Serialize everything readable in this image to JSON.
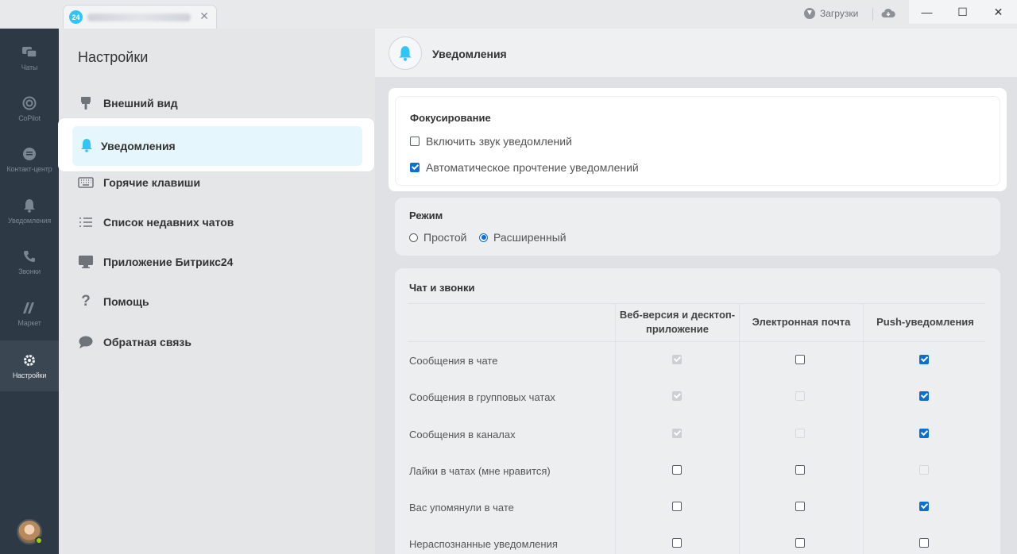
{
  "titlebar": {
    "tab_logo": "24",
    "downloads_label": "Загрузки",
    "close_glyph": "✕",
    "minimize_glyph": "—",
    "maximize_glyph": "☐",
    "tab_close_glyph": "✕"
  },
  "leftnav": {
    "items": [
      {
        "label": "Чаты",
        "icon": "chat-icon"
      },
      {
        "label": "CoPilot",
        "icon": "copilot-icon"
      },
      {
        "label": "Контакт-центр",
        "icon": "contact-center-icon"
      },
      {
        "label": "Уведомления",
        "icon": "bell-icon"
      },
      {
        "label": "Звонки",
        "icon": "phone-icon"
      },
      {
        "label": "Маркет",
        "icon": "market-icon"
      },
      {
        "label": "Настройки",
        "icon": "gear-icon",
        "active": true
      }
    ]
  },
  "sidebar": {
    "title": "Настройки",
    "items": [
      {
        "label": "Внешний вид",
        "icon": "brush-icon"
      },
      {
        "label": "Уведомления",
        "icon": "bell-icon",
        "active": true
      },
      {
        "label": "Горячие клавиши",
        "icon": "keyboard-icon"
      },
      {
        "label": "Список недавних чатов",
        "icon": "list-icon"
      },
      {
        "label": "Приложение Битрикс24",
        "icon": "monitor-icon"
      },
      {
        "label": "Помощь",
        "icon": "question-icon"
      },
      {
        "label": "Обратная связь",
        "icon": "speech-bubble-icon"
      }
    ]
  },
  "main": {
    "title": "Уведомления",
    "focus": {
      "title": "Фокусирование",
      "options": [
        {
          "label": "Включить звук уведомлений",
          "checked": false
        },
        {
          "label": "Автоматическое прочтение уведомлений",
          "checked": true
        }
      ]
    },
    "mode": {
      "title": "Режим",
      "options": [
        {
          "label": "Простой",
          "selected": false
        },
        {
          "label": "Расширенный",
          "selected": true
        }
      ]
    },
    "table": {
      "title": "Чат и звонки",
      "columns": [
        "Веб-версия и десктоп-приложение",
        "Электронная почта",
        "Push-уведомления"
      ],
      "rows": [
        {
          "label": "Сообщения в чате",
          "web": "disabled-checked",
          "email": "unchecked",
          "push": "checked"
        },
        {
          "label": "Сообщения в групповых чатах",
          "web": "disabled-checked",
          "email": "disabled",
          "push": "checked"
        },
        {
          "label": "Сообщения в каналах",
          "web": "disabled-checked",
          "email": "disabled",
          "push": "checked"
        },
        {
          "label": "Лайки в чатах (мне нравится)",
          "web": "unchecked",
          "email": "unchecked",
          "push": "disabled"
        },
        {
          "label": "Вас упомянули в чате",
          "web": "unchecked",
          "email": "unchecked",
          "push": "checked"
        },
        {
          "label": "Нераспознанные уведомления",
          "web": "unchecked",
          "email": "unchecked",
          "push": "unchecked"
        }
      ]
    }
  },
  "colors": {
    "accent": "#2fc6f6",
    "checkbox_checked": "#0c6fd1",
    "nav_bg": "#2d3a45"
  }
}
